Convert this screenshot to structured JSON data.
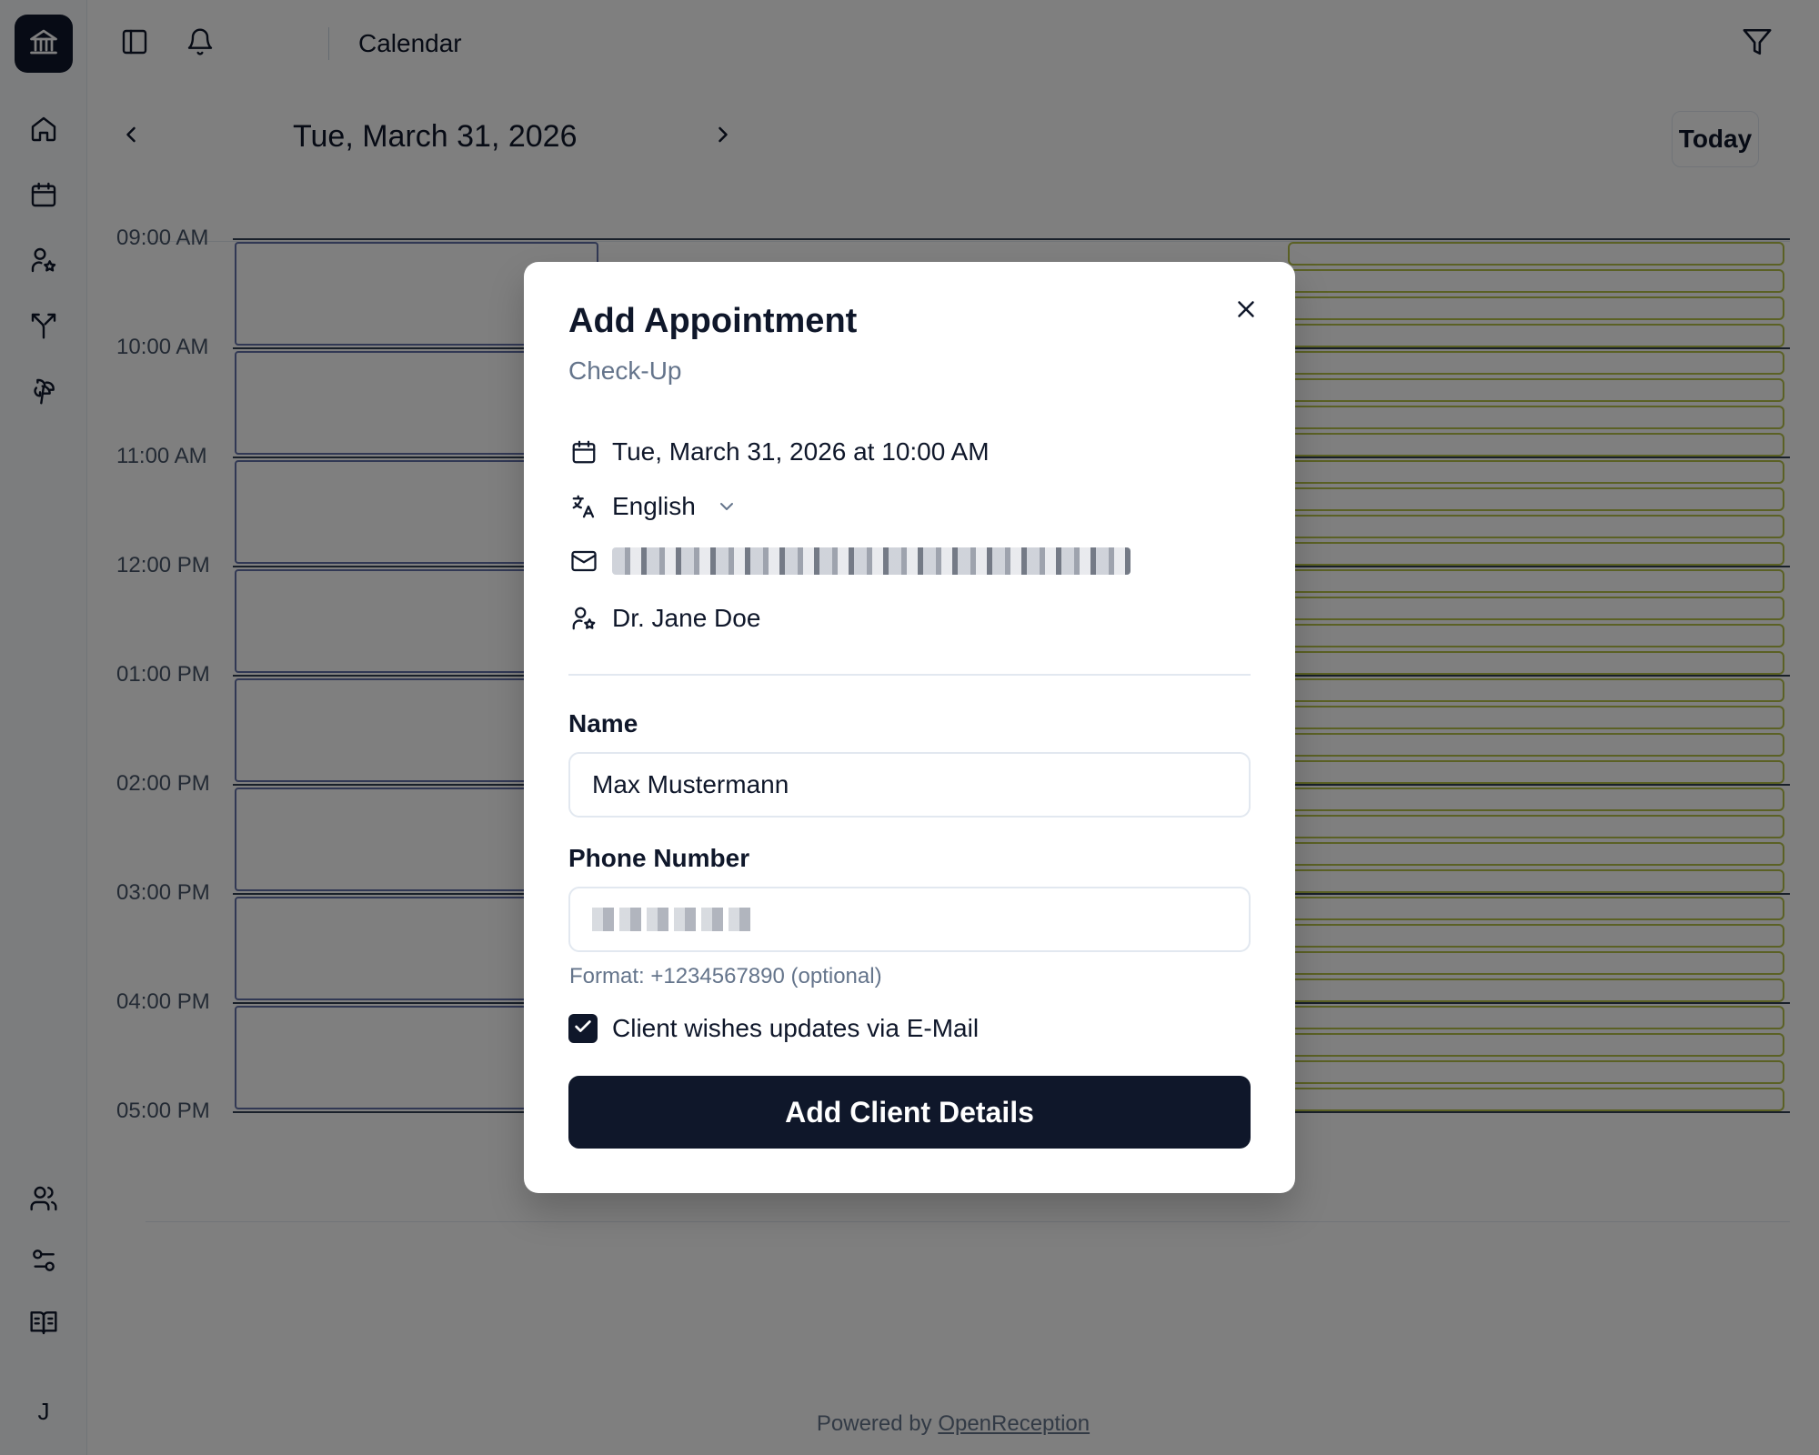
{
  "sidebar": {
    "logo_icon": "bank-icon",
    "items": [
      {
        "name": "home",
        "icon": "home-icon"
      },
      {
        "name": "calendar",
        "icon": "calendar-icon"
      },
      {
        "name": "providers",
        "icon": "user-star-icon"
      },
      {
        "name": "routing",
        "icon": "split-icon"
      },
      {
        "name": "vacation",
        "icon": "palm-tree-icon"
      },
      {
        "name": "users",
        "icon": "users-icon"
      },
      {
        "name": "settings",
        "icon": "sliders-icon"
      },
      {
        "name": "docs",
        "icon": "book-icon"
      }
    ],
    "avatar_initial": "J"
  },
  "header": {
    "title": "Calendar"
  },
  "date_nav": {
    "date": "Tue, March 31, 2026",
    "today_label": "Today"
  },
  "calendar": {
    "hours": [
      "09:00 AM",
      "10:00 AM",
      "11:00 AM",
      "12:00 PM",
      "01:00 PM",
      "02:00 PM",
      "03:00 PM",
      "04:00 PM",
      "05:00 PM"
    ]
  },
  "footer": {
    "prefix": "Powered by",
    "link": "OpenReception"
  },
  "modal": {
    "title": "Add Appointment",
    "subtitle": "Check-Up",
    "datetime": "Tue, March 31, 2026 at 10:00 AM",
    "language": "English",
    "provider": "Dr. Jane Doe",
    "name_label": "Name",
    "name_value": "Max Mustermann",
    "phone_label": "Phone Number",
    "phone_hint": "Format: +1234567890 (optional)",
    "email_updates_label": "Client wishes updates via E-Mail",
    "email_updates_checked": true,
    "submit_label": "Add Client Details"
  },
  "colors": {
    "primary": "#0f172a",
    "muted": "#64748b",
    "slot_border": "#6370a8",
    "available_border": "#b7c24a"
  }
}
